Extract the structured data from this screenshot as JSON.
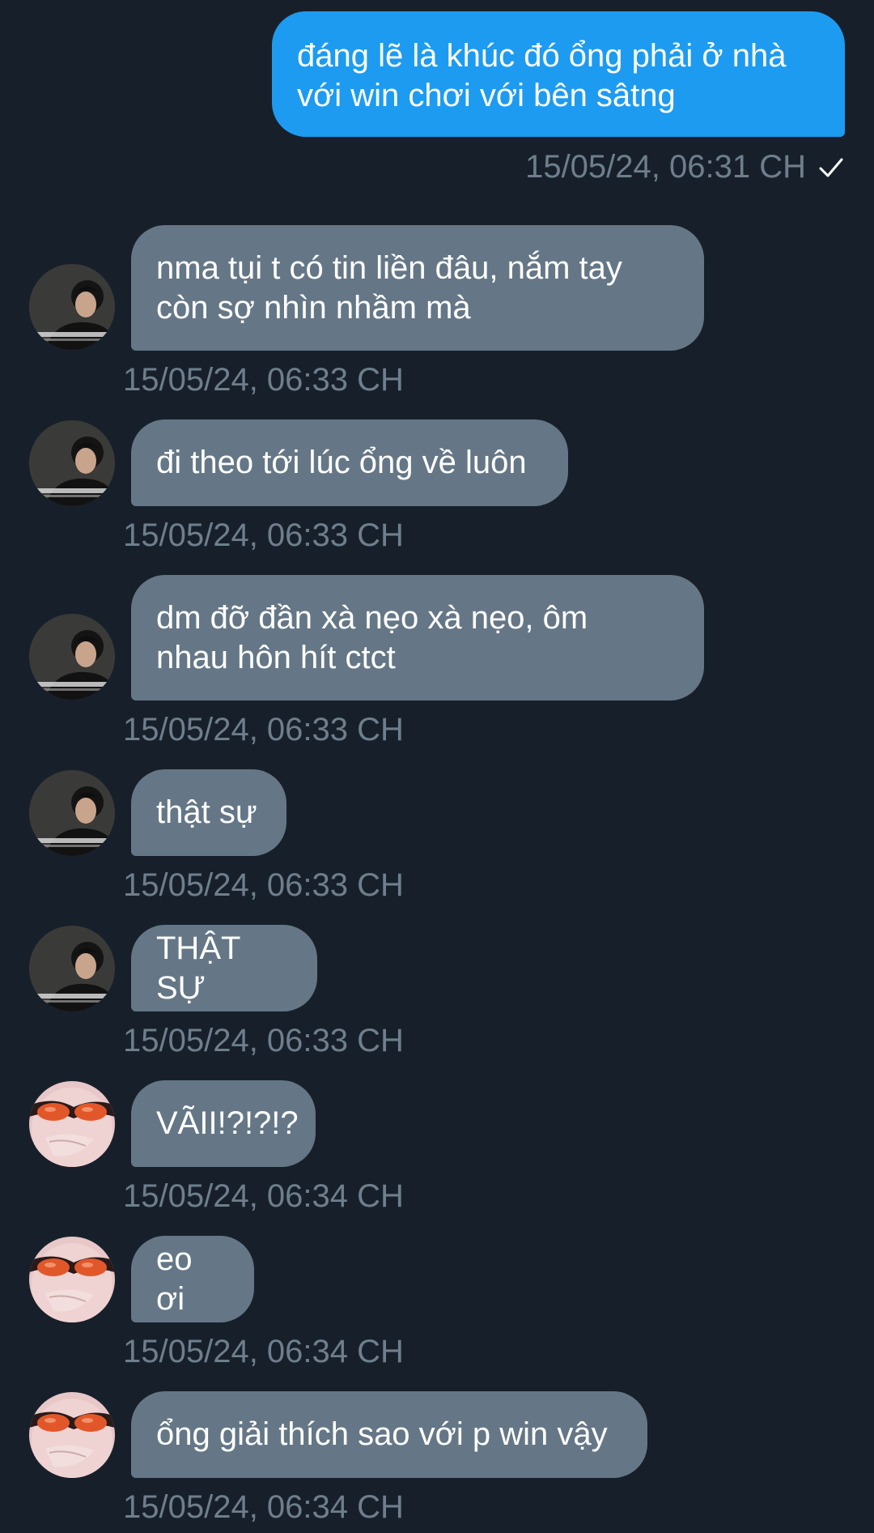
{
  "colors": {
    "background": "#17202a",
    "outgoing_bubble": "#1d9bf0",
    "incoming_bubble": "#657786",
    "timestamp": "#6e7e8c"
  },
  "outgoing": {
    "line1": "đáng lẽ là khúc đó ổng phải ở nhà",
    "line2": "với win chơi với bên sâtng",
    "timestamp": "15/05/24, 06:31 CH",
    "status_icon": "check-icon"
  },
  "messages": [
    {
      "lines": [
        "nma tụi t có tin liền đâu, nắm tay",
        "còn sợ nhìn nhầm mà"
      ],
      "timestamp": "15/05/24, 06:33 CH",
      "avatar": "dark-haired-person-avatar"
    },
    {
      "lines": [
        "đi theo tới lúc ổng về luôn"
      ],
      "timestamp": "15/05/24, 06:33 CH",
      "avatar": "dark-haired-person-avatar"
    },
    {
      "lines": [
        "dm đỡ đần xà nẹo xà nẹo, ôm",
        "nhau hôn hít ctct"
      ],
      "timestamp": "15/05/24, 06:33 CH",
      "avatar": "dark-haired-person-avatar"
    },
    {
      "lines": [
        "thật sự"
      ],
      "timestamp": "15/05/24, 06:33 CH",
      "avatar": "dark-haired-person-avatar"
    },
    {
      "lines": [
        "THẬT SỰ"
      ],
      "timestamp": "15/05/24, 06:33 CH",
      "avatar": "dark-haired-person-avatar"
    },
    {
      "lines": [
        "VÃII!?!?!?"
      ],
      "timestamp": "15/05/24, 06:34 CH",
      "avatar": "orange-sunglasses-avatar"
    },
    {
      "lines": [
        "eo ơi"
      ],
      "timestamp": "15/05/24, 06:34 CH",
      "avatar": "orange-sunglasses-avatar"
    },
    {
      "lines": [
        "ổng giải thích sao với p win vậy"
      ],
      "timestamp": "15/05/24, 06:34 CH",
      "avatar": "orange-sunglasses-avatar"
    }
  ]
}
